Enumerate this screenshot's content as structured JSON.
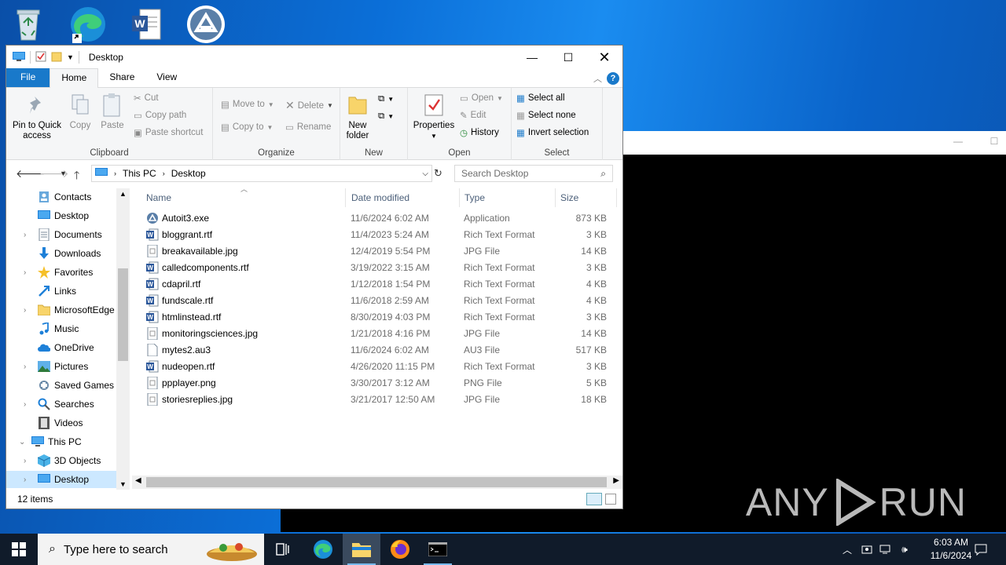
{
  "desktop": {
    "icons": [
      "recycle-bin-icon",
      "edge-icon",
      "word-icon",
      "autoit-icon"
    ]
  },
  "explorer": {
    "title": "Desktop",
    "tabs": [
      "File",
      "Home",
      "Share",
      "View"
    ],
    "help": "?",
    "ribbon": {
      "clipboard": {
        "label": "Clipboard",
        "pin": "Pin to Quick access",
        "copy": "Copy",
        "paste": "Paste",
        "cut": "Cut",
        "copy_path": "Copy path",
        "paste_shortcut": "Paste shortcut"
      },
      "organize": {
        "label": "Organize",
        "move_to": "Move to",
        "copy_to": "Copy to",
        "delete": "Delete",
        "rename": "Rename"
      },
      "new": {
        "label": "New",
        "new_folder": "New folder"
      },
      "open": {
        "label": "Open",
        "properties": "Properties",
        "open": "Open",
        "edit": "Edit",
        "history": "History"
      },
      "select": {
        "label": "Select",
        "select_all": "Select all",
        "select_none": "Select none",
        "invert": "Invert selection"
      }
    },
    "address": {
      "crumbs": [
        "This PC",
        "Desktop"
      ],
      "search_placeholder": "Search Desktop"
    },
    "nav": [
      {
        "label": "Contacts",
        "icon": "contacts-icon",
        "expand": false
      },
      {
        "label": "Desktop",
        "icon": "desktop-icon",
        "expand": false
      },
      {
        "label": "Documents",
        "icon": "documents-icon",
        "expand": true
      },
      {
        "label": "Downloads",
        "icon": "downloads-icon",
        "expand": false
      },
      {
        "label": "Favorites",
        "icon": "star-icon",
        "expand": true
      },
      {
        "label": "Links",
        "icon": "links-icon",
        "expand": false
      },
      {
        "label": "MicrosoftEdge",
        "icon": "folder-icon",
        "expand": true
      },
      {
        "label": "Music",
        "icon": "music-icon",
        "expand": false
      },
      {
        "label": "OneDrive",
        "icon": "onedrive-icon",
        "expand": false
      },
      {
        "label": "Pictures",
        "icon": "pictures-icon",
        "expand": true
      },
      {
        "label": "Saved Games",
        "icon": "saved-games-icon",
        "expand": false
      },
      {
        "label": "Searches",
        "icon": "search-icon",
        "expand": true
      },
      {
        "label": "Videos",
        "icon": "videos-icon",
        "expand": false
      },
      {
        "label": "This PC",
        "icon": "this-pc-icon",
        "expand": "open"
      },
      {
        "label": "3D Objects",
        "icon": "3d-objects-icon",
        "expand": true
      },
      {
        "label": "Desktop",
        "icon": "desktop-icon",
        "expand": true,
        "selected": true
      }
    ],
    "columns": {
      "name": "Name",
      "date": "Date modified",
      "type": "Type",
      "size": "Size"
    },
    "files": [
      {
        "name": "Autoit3.exe",
        "date": "11/6/2024 6:02 AM",
        "type": "Application",
        "size": "873 KB",
        "icon": "autoit"
      },
      {
        "name": "bloggrant.rtf",
        "date": "11/4/2023 5:24 AM",
        "type": "Rich Text Format",
        "size": "3 KB",
        "icon": "rtf"
      },
      {
        "name": "breakavailable.jpg",
        "date": "12/4/2019 5:54 PM",
        "type": "JPG File",
        "size": "14 KB",
        "icon": "img"
      },
      {
        "name": "calledcomponents.rtf",
        "date": "3/19/2022 3:15 AM",
        "type": "Rich Text Format",
        "size": "3 KB",
        "icon": "rtf"
      },
      {
        "name": "cdapril.rtf",
        "date": "1/12/2018 1:54 PM",
        "type": "Rich Text Format",
        "size": "4 KB",
        "icon": "rtf"
      },
      {
        "name": "fundscale.rtf",
        "date": "11/6/2018 2:59 AM",
        "type": "Rich Text Format",
        "size": "4 KB",
        "icon": "rtf"
      },
      {
        "name": "htmlinstead.rtf",
        "date": "8/30/2019 4:03 PM",
        "type": "Rich Text Format",
        "size": "3 KB",
        "icon": "rtf"
      },
      {
        "name": "monitoringsciences.jpg",
        "date": "1/21/2018 4:16 PM",
        "type": "JPG File",
        "size": "14 KB",
        "icon": "img"
      },
      {
        "name": "mytes2.au3",
        "date": "11/6/2024 6:02 AM",
        "type": "AU3 File",
        "size": "517 KB",
        "icon": "blank"
      },
      {
        "name": "nudeopen.rtf",
        "date": "4/26/2020 11:15 PM",
        "type": "Rich Text Format",
        "size": "3 KB",
        "icon": "rtf"
      },
      {
        "name": "ppplayer.png",
        "date": "3/30/2017 3:12 AM",
        "type": "PNG File",
        "size": "5 KB",
        "icon": "img"
      },
      {
        "name": "storiesreplies.jpg",
        "date": "3/21/2017 12:50 AM",
        "type": "JPG File",
        "size": "18 KB",
        "icon": "img"
      }
    ],
    "status": "12 items"
  },
  "taskbar": {
    "search_placeholder": "Type here to search",
    "time": "6:03 AM",
    "date": "11/6/2024"
  },
  "watermark": "ANY RUN"
}
